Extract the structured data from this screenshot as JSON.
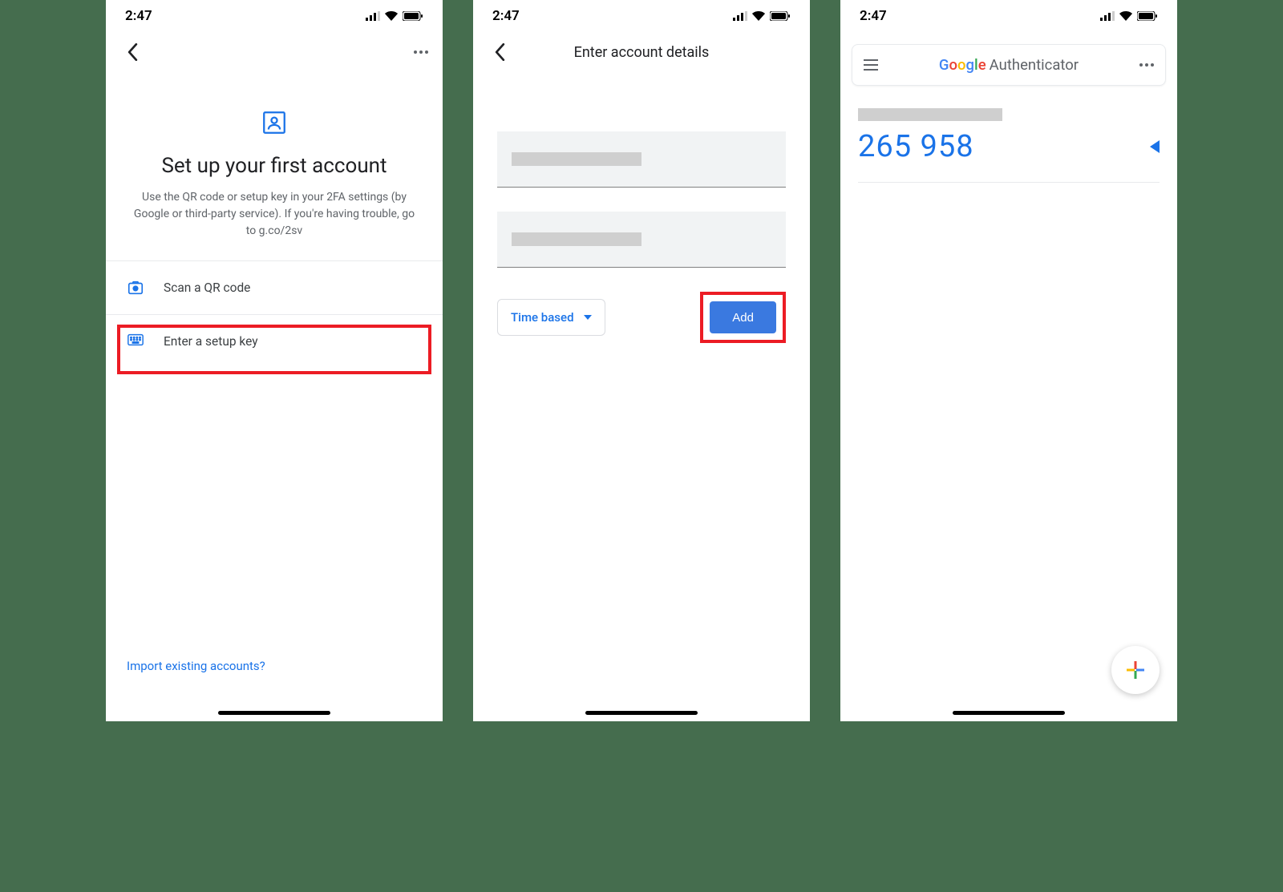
{
  "status": {
    "time": "2:47"
  },
  "screen1": {
    "title": "Set up your first account",
    "description": "Use the QR code or setup key in your 2FA settings (by Google or third-party service). If you're having trouble, go to g.co/2sv",
    "option_scan": "Scan a QR code",
    "option_key": "Enter a setup key",
    "import_link": "Import existing accounts?"
  },
  "screen2": {
    "title": "Enter account details",
    "dropdown_label": "Time based",
    "add_label": "Add"
  },
  "screen3": {
    "brand_suffix": "Authenticator",
    "code": "265 958"
  }
}
